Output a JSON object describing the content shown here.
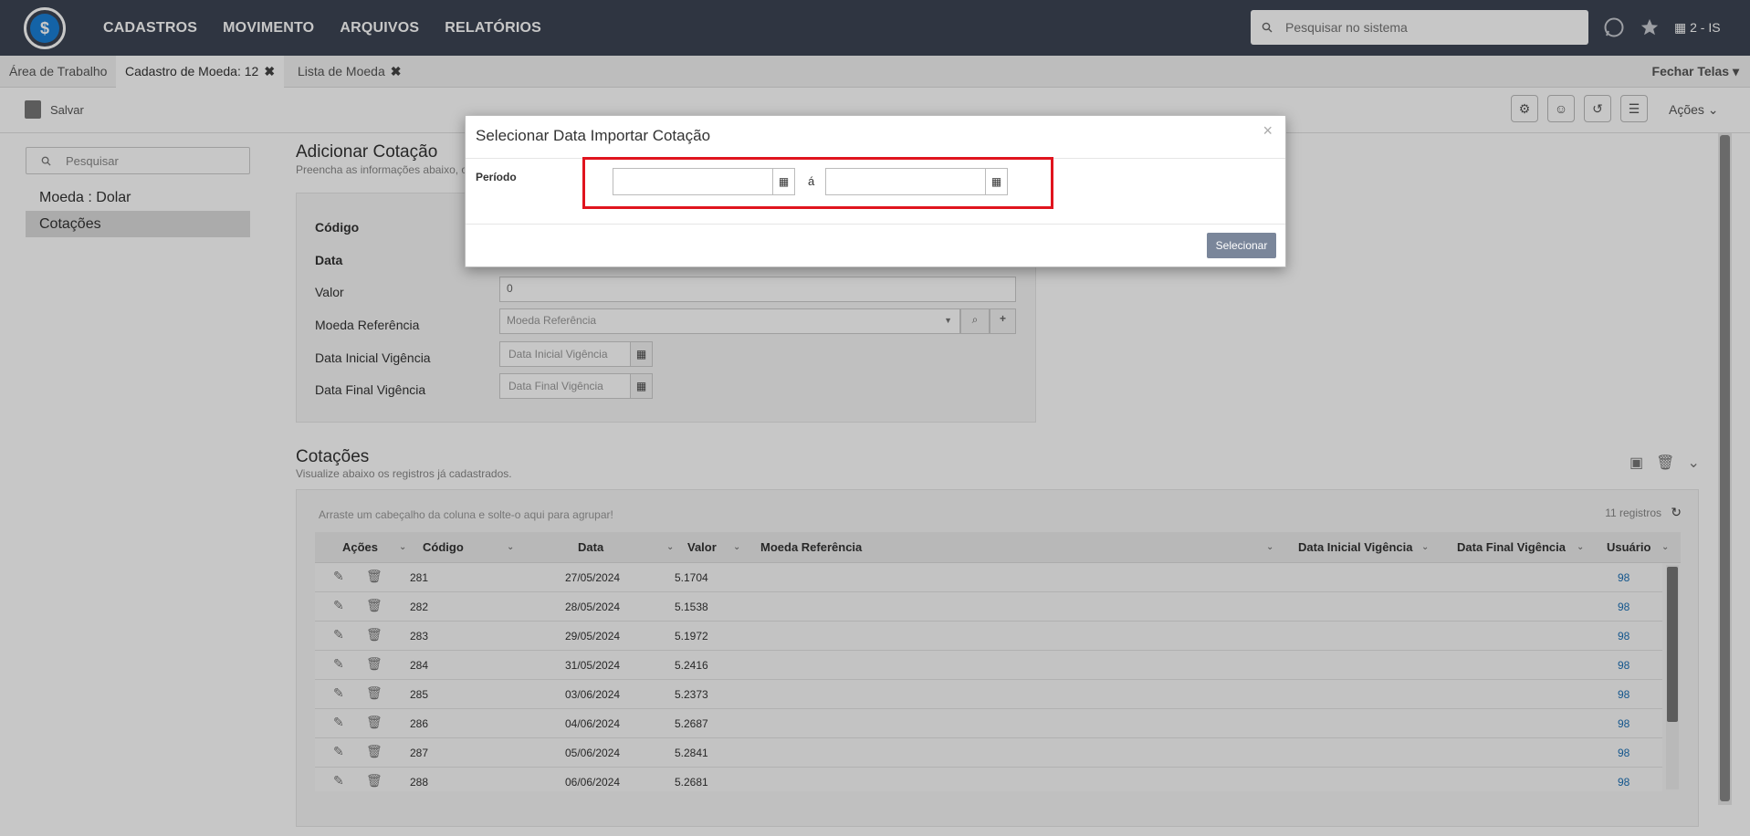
{
  "nav": {
    "logo_symbol": "$",
    "menu": [
      "CADASTROS",
      "MOVIMENTO",
      "ARQUIVOS",
      "RELATÓRIOS"
    ],
    "search_placeholder": "Pesquisar no sistema",
    "company": "2 - IS"
  },
  "tabs": [
    {
      "label": "Área de Trabalho"
    },
    {
      "label": "Cadastro de Moeda: 12"
    },
    {
      "label": "Lista de Moeda"
    }
  ],
  "fechar_telas": "Fechar Telas ▾",
  "toolbar": {
    "save_label": "Salvar",
    "acoes_label": "Ações ⌄"
  },
  "sidebar": {
    "search_placeholder": "Pesquisar",
    "items": [
      "Moeda : Dolar",
      "Cotações"
    ]
  },
  "form": {
    "title": "Adicionar Cotação",
    "subtitle": "Preencha as informações abaixo, os",
    "codigo_label": "Código",
    "data_label": "Data",
    "valor_label": "Valor",
    "valor_value": "0",
    "moeda_ref_label": "Moeda Referência",
    "moeda_ref_placeholder": "Moeda Referência",
    "data_inicial_label": "Data Inicial Vigência",
    "data_inicial_placeholder": "Data Inicial Vigência",
    "data_final_label": "Data Final Vigência",
    "data_final_placeholder": "Data Final Vigência"
  },
  "cotacoes": {
    "title": "Cotações",
    "subtitle": "Visualize abaixo os registros já cadastrados.",
    "group_hint": "Arraste um cabeçalho da coluna e solte-o aqui para agrupar!",
    "count": "11 registros",
    "columns": [
      "Ações",
      "Código",
      "Data",
      "Valor",
      "Moeda Referência",
      "Data Inicial Vigência",
      "Data Final Vigência",
      "Usuário"
    ],
    "rows": [
      {
        "codigo": "281",
        "data": "27/05/2024",
        "valor": "5.1704",
        "usuario": "98"
      },
      {
        "codigo": "282",
        "data": "28/05/2024",
        "valor": "5.1538",
        "usuario": "98"
      },
      {
        "codigo": "283",
        "data": "29/05/2024",
        "valor": "5.1972",
        "usuario": "98"
      },
      {
        "codigo": "284",
        "data": "31/05/2024",
        "valor": "5.2416",
        "usuario": "98"
      },
      {
        "codigo": "285",
        "data": "03/06/2024",
        "valor": "5.2373",
        "usuario": "98"
      },
      {
        "codigo": "286",
        "data": "04/06/2024",
        "valor": "5.2687",
        "usuario": "98"
      },
      {
        "codigo": "287",
        "data": "05/06/2024",
        "valor": "5.2841",
        "usuario": "98"
      },
      {
        "codigo": "288",
        "data": "06/06/2024",
        "valor": "5.2681",
        "usuario": "98"
      }
    ]
  },
  "modal": {
    "title": "Selecionar Data Importar Cotação",
    "periodo_label": "Período",
    "separator": "á",
    "select_label": "Selecionar",
    "highlight_color": "#e0141e"
  }
}
